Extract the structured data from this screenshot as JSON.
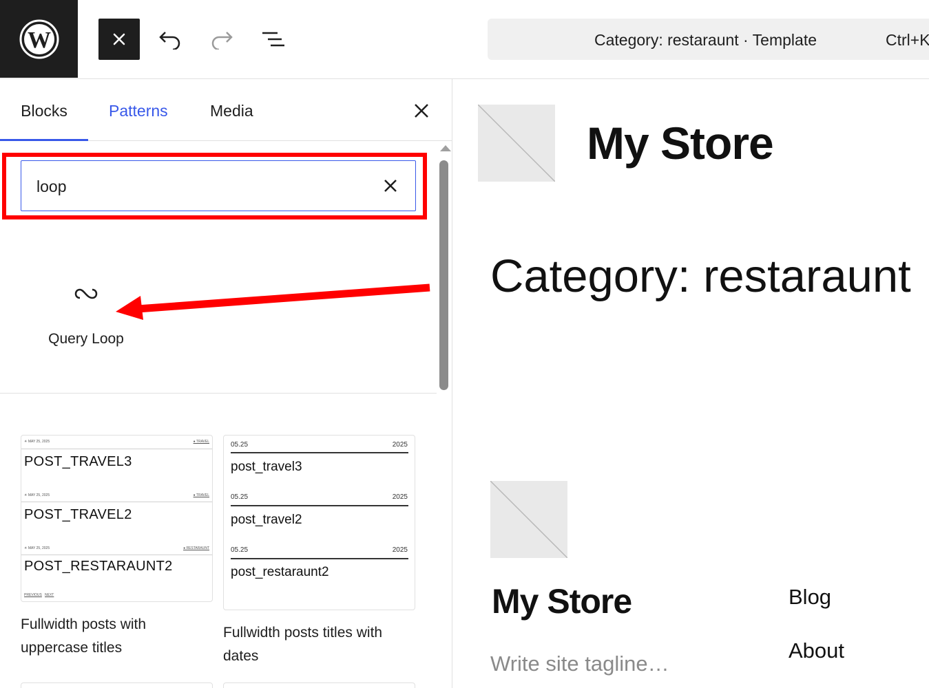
{
  "topbar": {
    "logo_label": "W",
    "document_title": "Category: restaraunt · Template",
    "document_shortcut": "Ctrl+K"
  },
  "inserter": {
    "tabs": [
      {
        "label": "Blocks"
      },
      {
        "label": "Patterns"
      },
      {
        "label": "Media"
      }
    ],
    "search": {
      "value": "loop"
    },
    "block_results": [
      {
        "label": "Query Loop",
        "icon": "loop-icon"
      }
    ],
    "patterns": [
      {
        "caption": "Fullwidth posts with uppercase titles",
        "rows": [
          {
            "meta": "☀ MAY 25, 2025",
            "tag": "● TRAVEL",
            "title": "POST_TRAVEL3"
          },
          {
            "meta": "☀ MAY 25, 2025",
            "tag": "● TRAVEL",
            "title": "POST_TRAVEL2"
          },
          {
            "meta": "☀ MAY 25, 2025",
            "tag": "● RESTARAUNT",
            "title": "POST_RESTARAUNT2"
          }
        ],
        "nav": {
          "previous": "PREVIOUS",
          "next": "NEXT"
        }
      },
      {
        "caption": "Fullwidth posts titles with dates",
        "rows": [
          {
            "date": "05.25",
            "year": "2025",
            "title": "post_travel3"
          },
          {
            "date": "05.25",
            "year": "2025",
            "title": "post_travel2"
          },
          {
            "date": "05.25",
            "year": "2025",
            "title": "post_restaraunt2"
          }
        ]
      }
    ]
  },
  "canvas": {
    "site_title": "My Store",
    "archive_title": "Category: restaraunt",
    "footer_site_title": "My Store",
    "tagline_placeholder": "Write site tagline…",
    "nav": [
      {
        "label": "Blog"
      },
      {
        "label": "About"
      }
    ]
  },
  "colors": {
    "accent": "#3858e9",
    "annotation": "#ff0000",
    "dark": "#1e1e1e"
  }
}
